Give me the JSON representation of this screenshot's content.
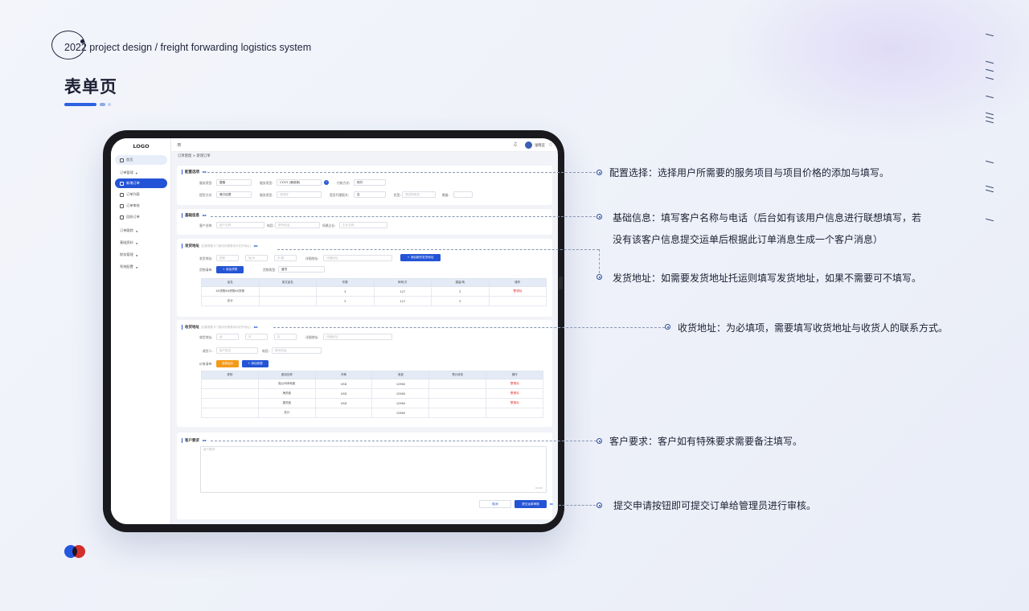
{
  "header": {
    "year": "2022",
    "subtitle": "project design / freight forwarding logistics system",
    "page_title": "表单页"
  },
  "app": {
    "logo": "LOGO",
    "nav": {
      "home": "首页",
      "order_mgmt": "订单管理",
      "new_order": "新增订单",
      "order_list": "订单列表",
      "order_review": "订单审核",
      "recycle": "回收订单",
      "order_track": "订单跟踪",
      "basic_data": "基础资料",
      "finance": "财务管理",
      "settings": "系统配置"
    },
    "user_name": "张晓宜",
    "breadcrumb": "订单管理 > 新增订单",
    "config": {
      "title": "配置选项",
      "service_type_label": "服务类型:",
      "service_type_value": "整箱",
      "service_class_label": "服务类型:",
      "service_class_value": "CY/CY (港到港)",
      "payment_label": "付款方式:",
      "payment_value": "现付",
      "port_label": "提货方式:",
      "port_value": "港口自提",
      "service2_label": "服务类型:",
      "service2_placeholder": "请选择",
      "agent_label": "是否代理报关:",
      "agent_value": "否",
      "box_label": "柜型:",
      "box_placeholder": "请选择柜型",
      "qty_label": "数量:"
    },
    "basic": {
      "title": "基础信息",
      "customer_label": "客户名称:",
      "customer_placeholder": "客户名称",
      "phone_label": "电话:",
      "phone_placeholder": "联系电话",
      "company_label": "所属企业:",
      "company_placeholder": "企业名称"
    },
    "shipper": {
      "title": "发货地址",
      "hint": "(如果需要卡门服务则需要填写发货地址)",
      "addr_label": "发货地址:",
      "province": "国家",
      "city": "省/州",
      "district": "市/镇",
      "detail_label": "详细地址:",
      "detail_placeholder": "详细地址",
      "add_addr": "+ 添加新的发货地址",
      "goods_label": "货物清单:",
      "add_goods": "+ 添加货物",
      "goods_type_label": "货物类型:",
      "goods_type_value": "普货",
      "table_headers": [
        "品名",
        "英文品名",
        "件数",
        "体积/方",
        "重量/吨",
        "操作"
      ],
      "rows": [
        [
          "XX货物XX货物XX货物",
          "",
          "3",
          "127",
          "3",
          "删除"
        ],
        [
          "总计",
          "",
          "3",
          "127",
          "3",
          ""
        ]
      ]
    },
    "consignee": {
      "title": "收货地址",
      "hint": "(如果需要卡门服务则需要填写收货地址)",
      "addr_label": "收货地址:",
      "province": "省",
      "city": "市",
      "district": "区",
      "detail_label": "详细地址:",
      "detail_placeholder": "详细地址",
      "contact_label": "收货人:",
      "contact_placeholder": "客户姓名",
      "phone_label": "电话:",
      "phone_placeholder": "联系电话",
      "price_label": "价格清单:",
      "choose_btn": "选择运价",
      "add_fee_btn": "+ 添加收费",
      "table_headers": [
        "类别",
        "费用名称",
        "币种",
        "收费",
        "预计成本",
        "操作"
      ],
      "rows": [
        [
          "",
          "船公司本地费",
          "USD",
          "12960",
          "",
          "删除"
        ],
        [
          "",
          "海关费",
          "USD",
          "12960",
          "",
          "删除"
        ],
        [
          "",
          "报关费",
          "USD",
          "12960",
          "",
          "删除"
        ],
        [
          "",
          "总计",
          "",
          "12960",
          "",
          ""
        ]
      ]
    },
    "remarks": {
      "title": "客户要求",
      "placeholder": "客户要求",
      "counter": "0/200"
    },
    "cancel_btn": "取消",
    "submit_btn": "提交运单审核"
  },
  "annotations": {
    "a1": "配置选择：选择用户所需要的服务项目与项目价格的添加与填写。",
    "a2_line1": "基础信息：填写客户名称与电话（后台如有该用户信息进行联想填写，若",
    "a2_line2": "没有该客户信息提交运单后根据此订单消息生成一个客户消息）",
    "a3": "发货地址：如需要发货地址托运则填写发货地址，如果不需要可不填写。",
    "a4": "收货地址：为必填项，需要填写收货地址与收货人的联系方式。",
    "a5": "客户要求：客户如有特殊要求需要备注填写。",
    "a6": "提交申请按钮即可提交订单给管理员进行审核。"
  },
  "colors": {
    "accent": "#2454d6",
    "orange": "#f49a1a",
    "red": "#e2322c",
    "tablet": "#1a1a1e"
  }
}
